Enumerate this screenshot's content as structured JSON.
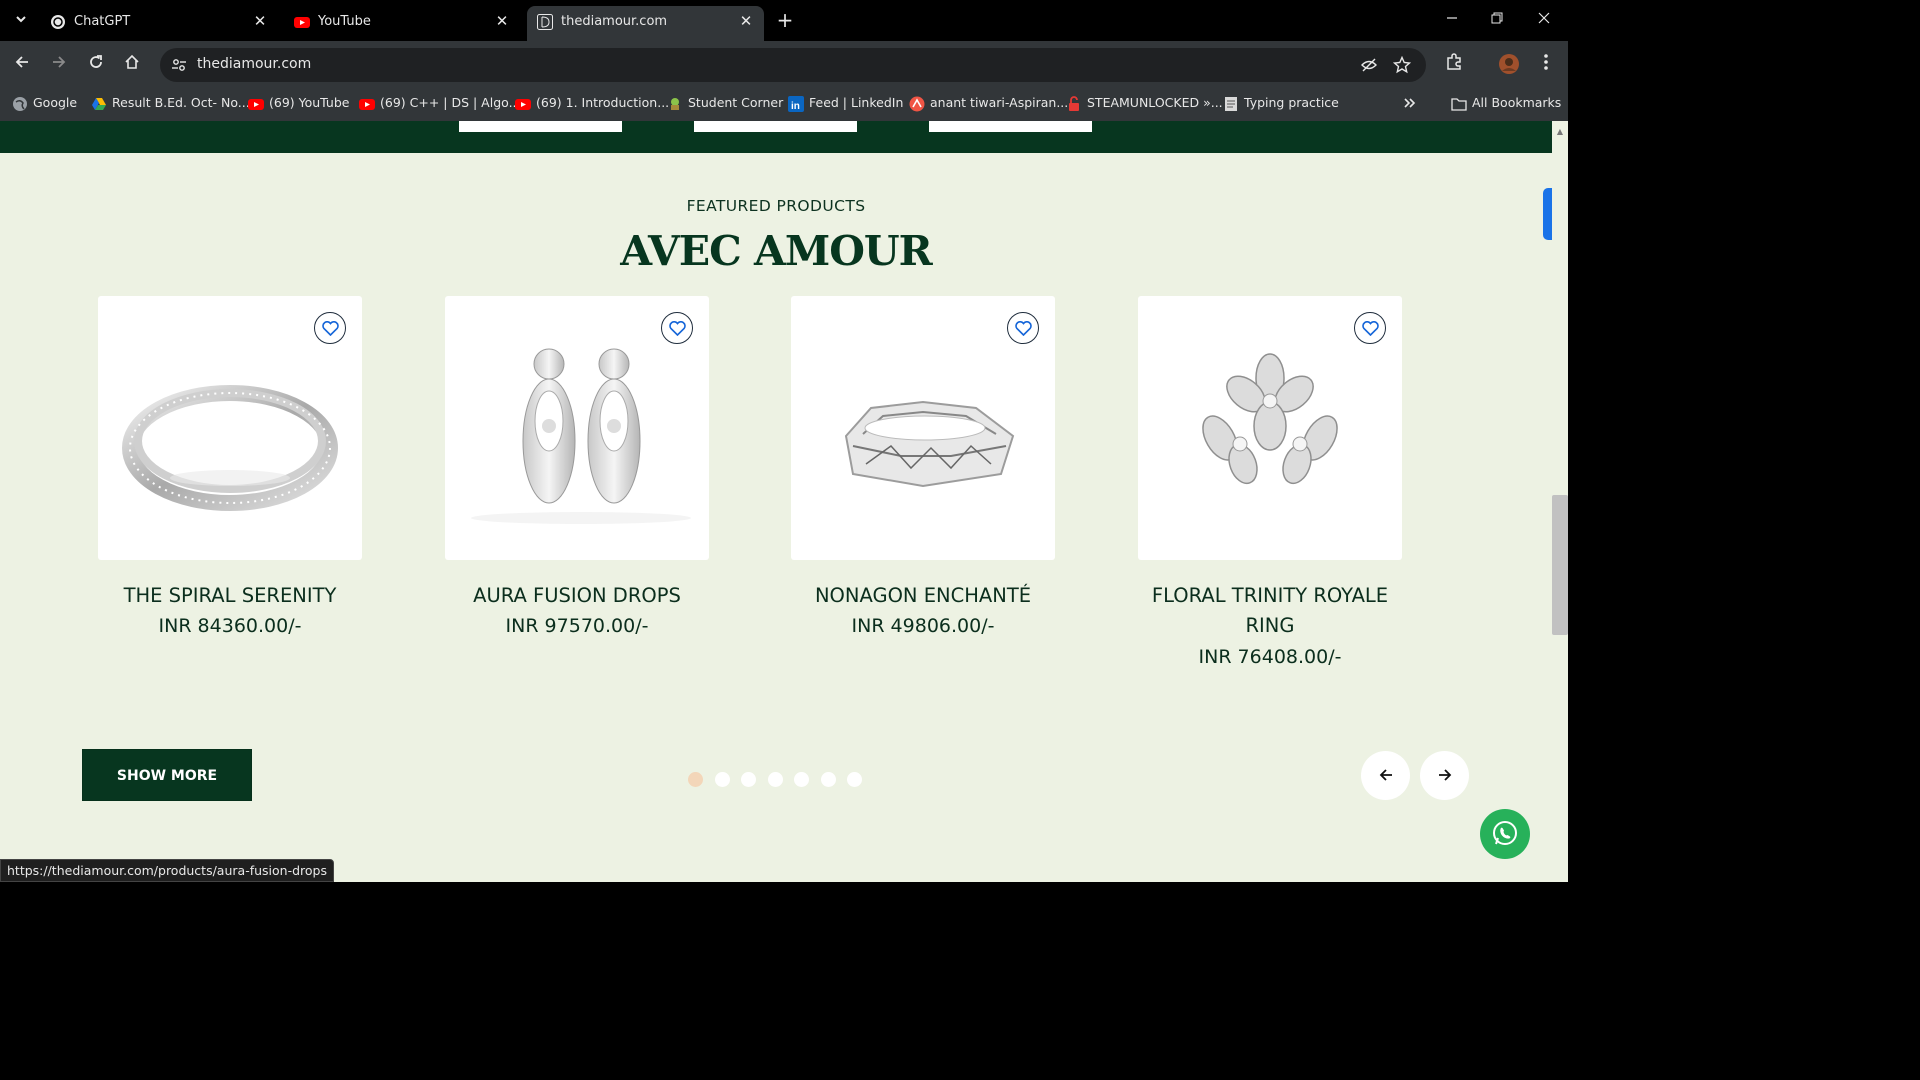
{
  "browser": {
    "tabs": [
      {
        "title": "ChatGPT"
      },
      {
        "title": "YouTube"
      },
      {
        "title": "thediamour.com"
      }
    ],
    "address": "thediamour.com",
    "bookmarks": [
      {
        "label": "Google"
      },
      {
        "label": "Result B.Ed. Oct- No..."
      },
      {
        "label": "(69) YouTube"
      },
      {
        "label": "(69) C++ | DS | Algo..."
      },
      {
        "label": "(69) 1. Introduction..."
      },
      {
        "label": "Student Corner"
      },
      {
        "label": "Feed | LinkedIn"
      },
      {
        "label": "anant tiwari-Aspiran..."
      },
      {
        "label": "STEAMUNLOCKED »..."
      },
      {
        "label": "Typing practice"
      }
    ],
    "all_bookmarks": "All Bookmarks",
    "status_url": "https://thediamour.com/products/aura-fusion-drops"
  },
  "section": {
    "kicker": "FEATURED PRODUCTS",
    "heading": "AVEC AMOUR"
  },
  "products": [
    {
      "name": "THE SPIRAL SERENITY",
      "price": "INR 84360.00/-"
    },
    {
      "name": "AURA FUSION DROPS",
      "price": "INR 97570.00/-"
    },
    {
      "name": "NONAGON ENCHANTÉ",
      "price": "INR 49806.00/-"
    },
    {
      "name_line1": "FLORAL TRINITY ROYALE",
      "name_line2": "RING",
      "price": "INR 76408.00/-"
    }
  ],
  "show_more": "SHOW MORE",
  "carousel": {
    "pages": 7,
    "active": 1
  },
  "colors": {
    "brand_green": "#07361f",
    "page_bg": "#edf2e3",
    "dot_active": "#f3d6b9",
    "whatsapp": "#27b15a"
  }
}
